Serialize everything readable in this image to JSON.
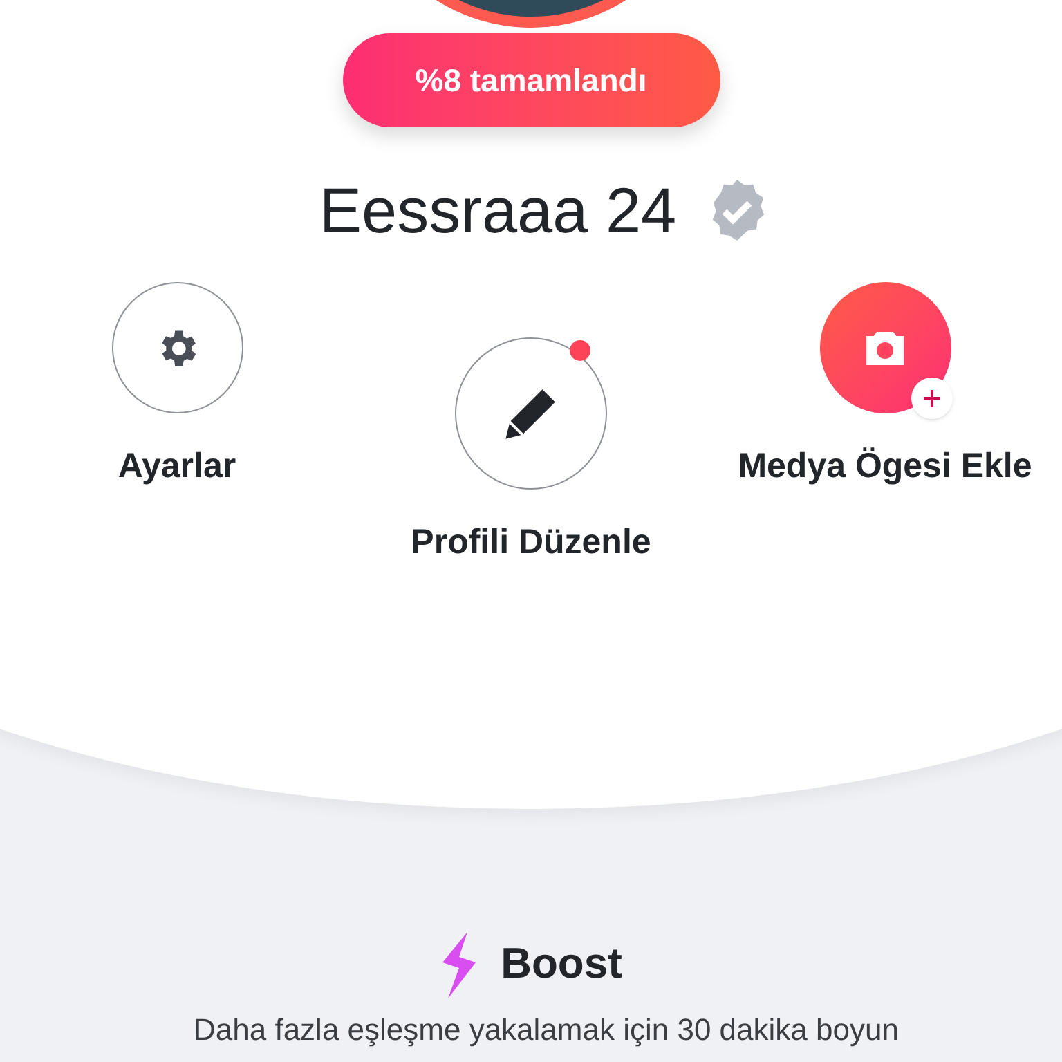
{
  "profile": {
    "completion": "%8 tamamlandı",
    "name": "Eessraaa",
    "age": "24",
    "verified": true
  },
  "actions": [
    {
      "kind": "settings",
      "label": "Ayarlar",
      "notification": false
    },
    {
      "kind": "edit",
      "label": "Profili Düzenle",
      "notification": true
    },
    {
      "kind": "media",
      "label": "Medya Ögesi Ekle",
      "notification": false
    }
  ],
  "boost": {
    "title": "Boost",
    "description": "Daha fazla eşleşme yakalamak için 30 dakika boyun"
  }
}
